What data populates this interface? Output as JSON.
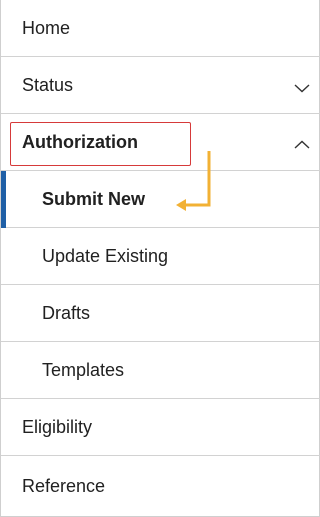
{
  "nav": {
    "home": "Home",
    "status": "Status",
    "authorization": "Authorization",
    "submit_new": "Submit New",
    "update_existing": "Update Existing",
    "drafts": "Drafts",
    "templates": "Templates",
    "eligibility": "Eligibility",
    "reference": "Reference"
  },
  "state": {
    "status_expanded": false,
    "authorization_expanded": true,
    "active_item": "Submit New"
  },
  "icons": {
    "status_chevron": "chevron-down-icon",
    "authorization_chevron": "chevron-up-icon",
    "annotation_arrow": "arrow-icon"
  },
  "colors": {
    "active_bar": "#1f5fa6",
    "highlight_box": "#d63a3a",
    "arrow": "#f2b134"
  }
}
